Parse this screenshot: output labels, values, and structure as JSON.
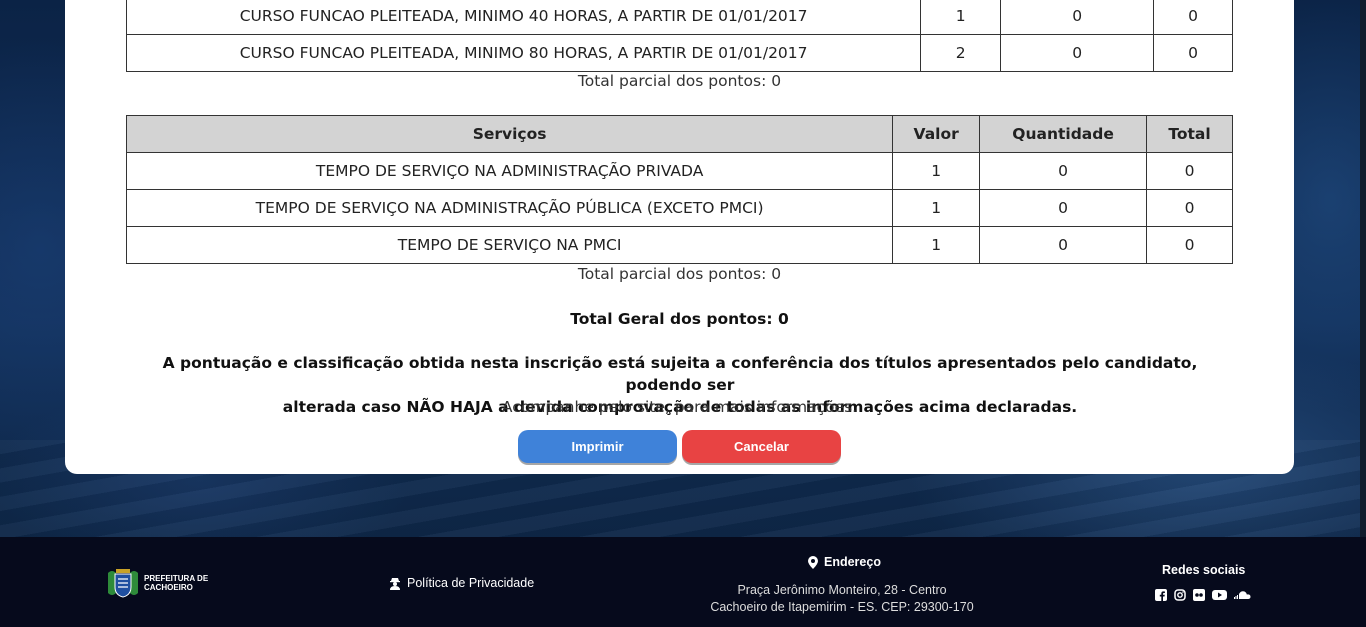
{
  "course_table": {
    "rows": [
      {
        "item": "CURSO FUNCAO PLEITEADA, MINIMO 40 HORAS, A PARTIR DE 01/01/2017",
        "valor": "1",
        "quantidade": "0",
        "total": "0"
      },
      {
        "item": "CURSO FUNCAO PLEITEADA, MINIMO 80 HORAS, A PARTIR DE 01/01/2017",
        "valor": "2",
        "quantidade": "0",
        "total": "0"
      }
    ],
    "subtotal": "Total parcial dos pontos: 0"
  },
  "services_table": {
    "headers": {
      "item": "Serviços",
      "valor": "Valor",
      "quantidade": "Quantidade",
      "total": "Total"
    },
    "rows": [
      {
        "item": "TEMPO DE SERVIÇO NA ADMINISTRAÇÃO PRIVADA",
        "valor": "1",
        "quantidade": "0",
        "total": "0"
      },
      {
        "item": "TEMPO DE SERVIÇO NA ADMINISTRAÇÃO PÚBLICA (EXCETO PMCI)",
        "valor": "1",
        "quantidade": "0",
        "total": "0"
      },
      {
        "item": "TEMPO DE SERVIÇO NA PMCI",
        "valor": "1",
        "quantidade": "0",
        "total": "0"
      }
    ],
    "subtotal": "Total parcial dos pontos: 0"
  },
  "grand_total": "Total Geral dos pontos: 0",
  "notice": {
    "line1": "A pontuação e classificação obtida nesta inscrição está sujeita a conferência dos títulos apresentados pelo candidato, podendo ser",
    "line2": "alterada caso NÃO HAJA a devida comprovação de todas as informações acima declaradas.",
    "follow": "Acompanhe pelo site, para mais informações."
  },
  "buttons": {
    "print": "Imprimir",
    "cancel": "Cancelar"
  },
  "colors": {
    "print": "#3f82d9",
    "cancel": "#e84343",
    "footer_bg": "#060a1c"
  },
  "footer": {
    "logo_line1": "PREFEITURA DE",
    "logo_line2": "CACHOEIRO",
    "privacy": "Política de Privacidade",
    "address_title": "Endereço",
    "address_line1": "Praça Jerônimo Monteiro, 28 - Centro",
    "address_line2": "Cachoeiro de Itapemirim - ES. CEP: 29300-170",
    "social_title": "Redes sociais",
    "social_icons": [
      "facebook-icon",
      "instagram-icon",
      "flickr-icon",
      "youtube-icon",
      "soundcloud-icon"
    ]
  }
}
